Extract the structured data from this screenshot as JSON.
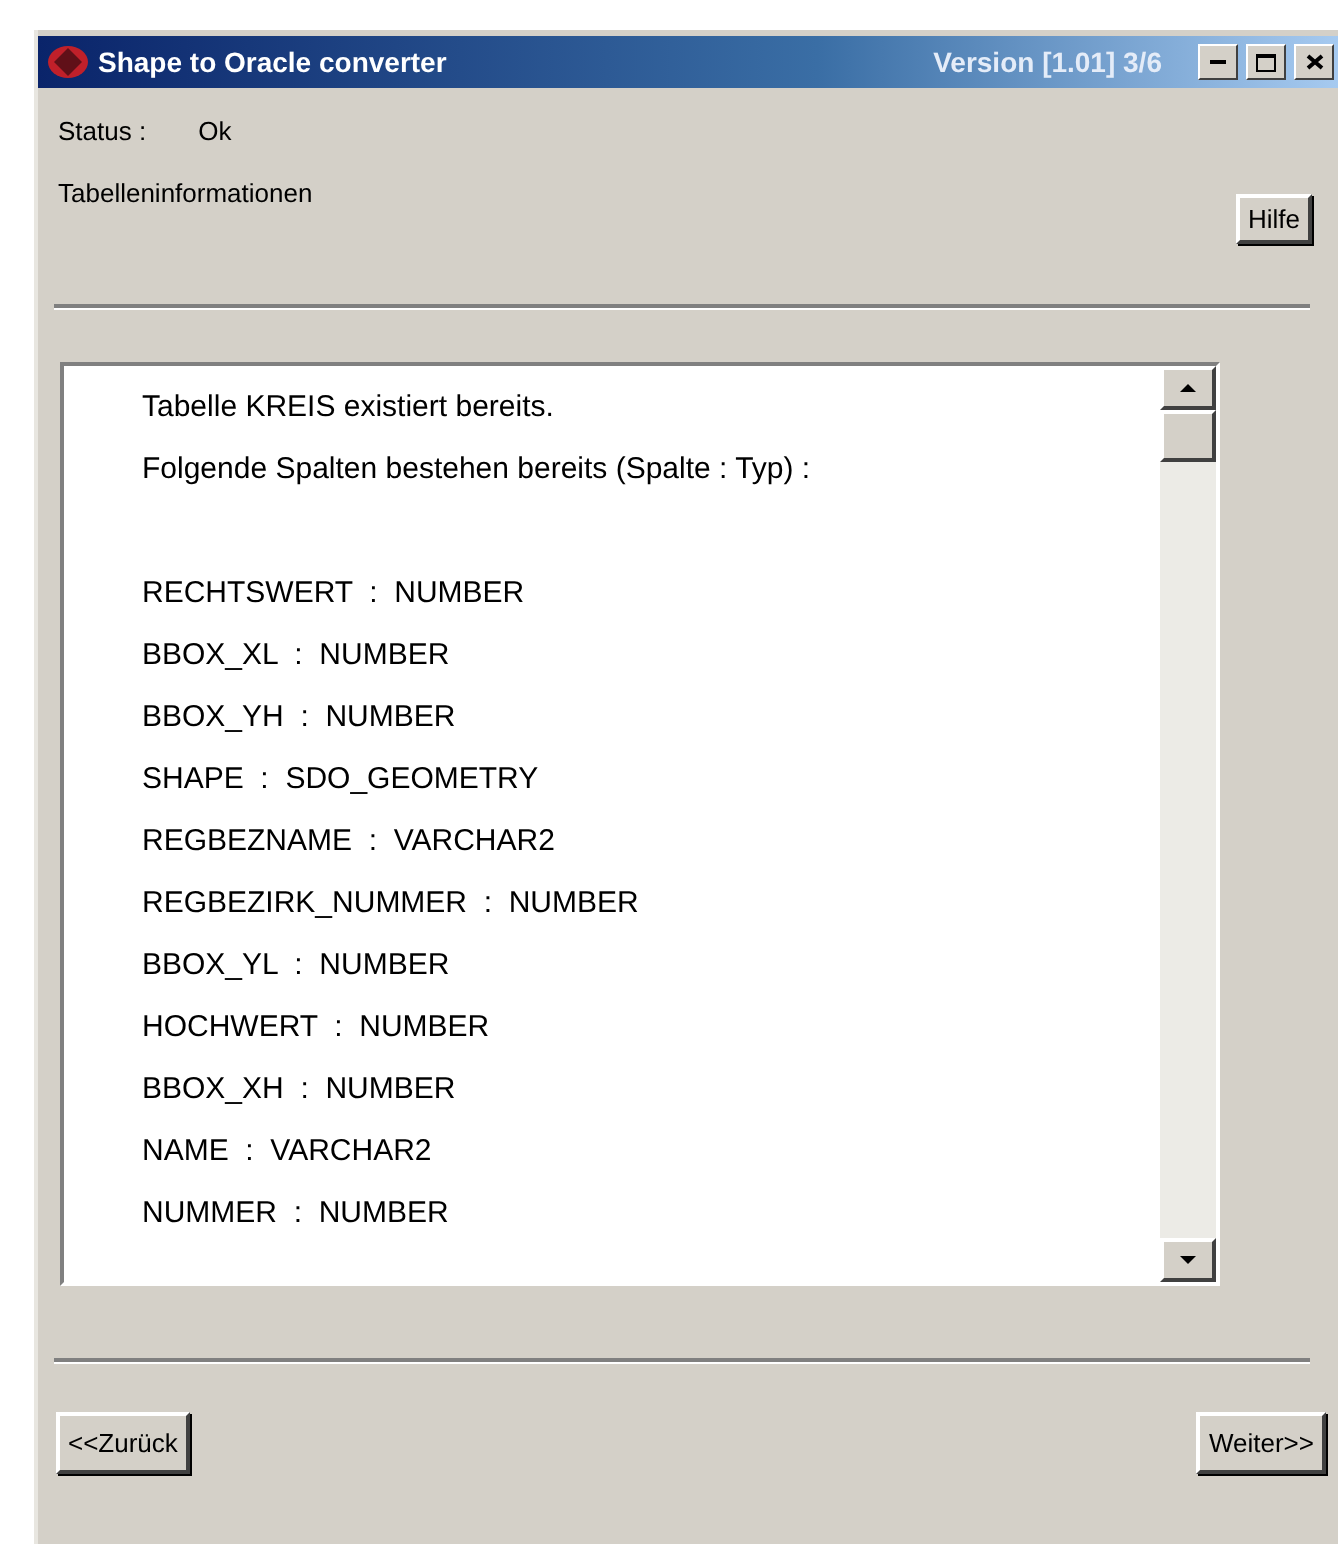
{
  "window": {
    "title": "Shape to Oracle converter",
    "version": "Version [1.01] 3/6"
  },
  "status": {
    "label": "Status :",
    "value": "Ok"
  },
  "section_title": "Tabelleninformationen",
  "help_button": "Hilfe",
  "info_lines": [
    "Tabelle KREIS existiert bereits.",
    "Folgende Spalten bestehen bereits (Spalte : Typ) :"
  ],
  "column_lines": [
    "RECHTSWERT  :  NUMBER",
    "BBOX_XL  :  NUMBER",
    "BBOX_YH  :  NUMBER",
    "SHAPE  :  SDO_GEOMETRY",
    "REGBEZNAME  :  VARCHAR2",
    "REGBEZIRK_NUMMER  :  NUMBER",
    "BBOX_YL  :  NUMBER",
    "HOCHWERT  :  NUMBER",
    "BBOX_XH  :  NUMBER",
    "NAME  :  VARCHAR2",
    "NUMMER  :  NUMBER"
  ],
  "buttons": [
    "<<Zurück",
    "Weiter>>"
  ]
}
